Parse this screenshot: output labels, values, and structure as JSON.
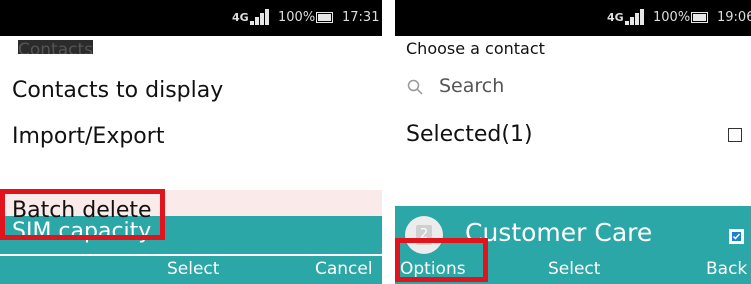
{
  "left_screen": {
    "status": {
      "network": "4G",
      "battery": "100%",
      "time": "17:31"
    },
    "ghost_title": "Contacts",
    "menu": [
      {
        "label": "Contacts to display"
      },
      {
        "label": "Import/Export"
      },
      {
        "label": "Batch delete"
      },
      {
        "label": "SIM capacity"
      }
    ],
    "softkeys": {
      "left": "",
      "center": "Select",
      "right": "Cancel"
    }
  },
  "right_screen": {
    "status": {
      "network": "4G",
      "battery": "100%",
      "time": "19:06"
    },
    "title": "Choose a contact",
    "search_placeholder": "Search",
    "selected_label": "Selected(1)",
    "contact": {
      "avatar_number": "2",
      "name": "Customer Care"
    },
    "softkeys": {
      "left": "Options",
      "center": "Select",
      "right": "Back"
    }
  },
  "colors": {
    "accent": "#2aa7a6",
    "highlight_box": "#e1141d",
    "checkbox": "#1f7fd1"
  }
}
